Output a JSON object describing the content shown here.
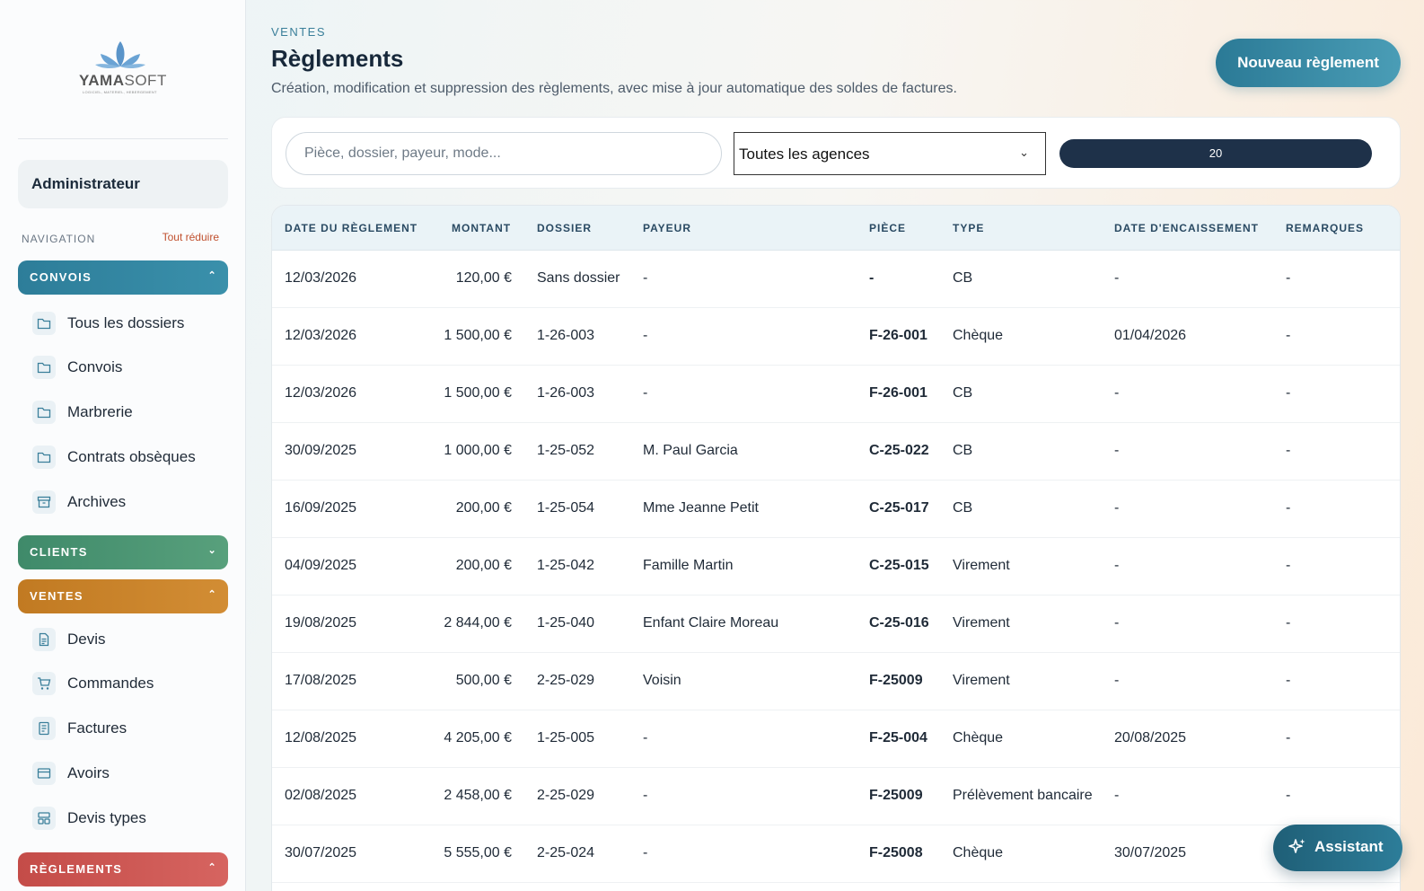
{
  "sidebar": {
    "logo": {
      "brand_bold": "YAMA",
      "brand_thin": "SOFT",
      "tagline": "LOGICIEL, MATERIEL, HEBERGEMENT"
    },
    "user": "Administrateur",
    "nav_label": "NAVIGATION",
    "collapse_all": "Tout réduire",
    "groups": {
      "convois": {
        "label": "CONVOIS",
        "expanded": true,
        "color": "#2d7d99",
        "items": [
          {
            "label": "Tous les dossiers",
            "icon": "folder-icon"
          },
          {
            "label": "Convois",
            "icon": "folder-icon"
          },
          {
            "label": "Marbrerie",
            "icon": "folder-icon"
          },
          {
            "label": "Contrats obsèques",
            "icon": "folder-icon"
          },
          {
            "label": "Archives",
            "icon": "archive-icon"
          }
        ]
      },
      "clients": {
        "label": "CLIENTS",
        "expanded": false,
        "color": "#3f8a6a"
      },
      "ventes": {
        "label": "VENTES",
        "expanded": true,
        "color": "#c17a22",
        "items": [
          {
            "label": "Devis",
            "icon": "document-icon"
          },
          {
            "label": "Commandes",
            "icon": "cart-icon"
          },
          {
            "label": "Factures",
            "icon": "invoice-icon"
          },
          {
            "label": "Avoirs",
            "icon": "card-icon"
          },
          {
            "label": "Devis types",
            "icon": "template-icon"
          }
        ]
      },
      "reglements": {
        "label": "RÈGLEMENTS",
        "expanded": true,
        "color": "#c44c48"
      }
    }
  },
  "header": {
    "breadcrumb": "VENTES",
    "title": "Règlements",
    "subtitle": "Création, modification et suppression des règlements, avec mise à jour automatique des soldes de factures.",
    "new_button": "Nouveau règlement"
  },
  "filters": {
    "search_placeholder": "Pièce, dossier, payeur, mode...",
    "search_value": "",
    "agency_selected": "Toutes les agences",
    "page_size": "20"
  },
  "table": {
    "columns": [
      "DATE DU RÈGLEMENT",
      "MONTANT",
      "DOSSIER",
      "PAYEUR",
      "PIÈCE",
      "TYPE",
      "DATE D'ENCAISSEMENT",
      "REMARQUES"
    ],
    "rows": [
      [
        "12/03/2026",
        "120,00 €",
        "Sans dossier",
        "-",
        "-",
        "CB",
        "-",
        "-"
      ],
      [
        "12/03/2026",
        "1 500,00 €",
        "1-26-003",
        "-",
        "F-26-001",
        "Chèque",
        "01/04/2026",
        "-"
      ],
      [
        "12/03/2026",
        "1 500,00 €",
        "1-26-003",
        "-",
        "F-26-001",
        "CB",
        "-",
        "-"
      ],
      [
        "30/09/2025",
        "1 000,00 €",
        "1-25-052",
        "M. Paul Garcia",
        "C-25-022",
        "CB",
        "-",
        "-"
      ],
      [
        "16/09/2025",
        "200,00 €",
        "1-25-054",
        "Mme Jeanne Petit",
        "C-25-017",
        "CB",
        "-",
        "-"
      ],
      [
        "04/09/2025",
        "200,00 €",
        "1-25-042",
        "Famille Martin",
        "C-25-015",
        "Virement",
        "-",
        "-"
      ],
      [
        "19/08/2025",
        "2 844,00 €",
        "1-25-040",
        "Enfant Claire Moreau",
        "C-25-016",
        "Virement",
        "-",
        "-"
      ],
      [
        "17/08/2025",
        "500,00 €",
        "2-25-029",
        "Voisin",
        "F-25009",
        "Virement",
        "-",
        "-"
      ],
      [
        "12/08/2025",
        "4 205,00 €",
        "1-25-005",
        "-",
        "F-25-004",
        "Chèque",
        "20/08/2025",
        "-"
      ],
      [
        "02/08/2025",
        "2 458,00 €",
        "2-25-029",
        "-",
        "F-25009",
        "Prélèvement bancaire",
        "-",
        "-"
      ],
      [
        "30/07/2025",
        "5 555,00 €",
        "2-25-024",
        "-",
        "F-25008",
        "Chèque",
        "30/07/2025",
        ""
      ]
    ]
  },
  "assistant": {
    "label": "Assistant",
    "icon": "sparkle-icon"
  },
  "colors": {
    "accent": "#2d7d99",
    "pager": "#1e3149",
    "collapse_link": "#c0502e"
  }
}
